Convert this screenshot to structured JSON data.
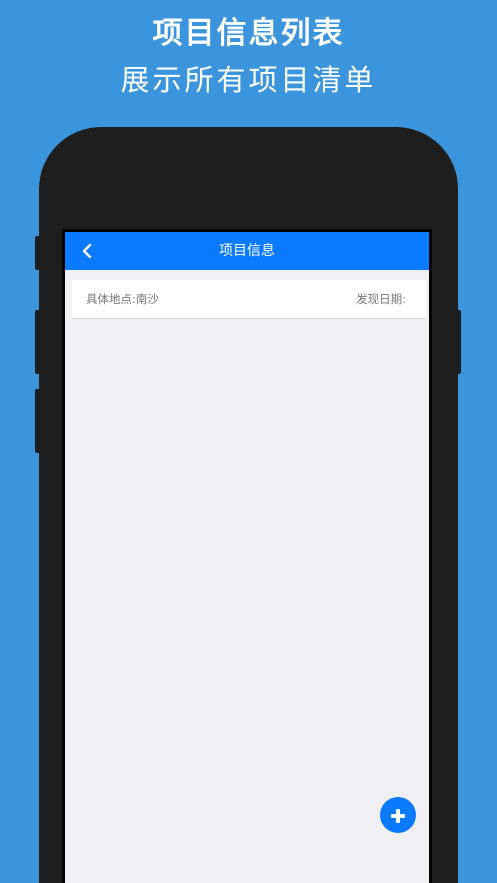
{
  "promo": {
    "title": "项目信息列表",
    "subtitle": "展示所有项目清单"
  },
  "navbar": {
    "title": "项目信息",
    "back_icon": "chevron-left-icon",
    "background": "#0A7AFF"
  },
  "list": {
    "items": [
      {
        "location": "具体地点:南沙",
        "date": "发现日期:"
      }
    ]
  },
  "fab": {
    "icon": "plus-icon",
    "color": "#0A7AFF"
  },
  "colors": {
    "page_background": "#3A95DC",
    "phone_body": "#1E1E1E",
    "screen_background": "#EFEFF4"
  }
}
